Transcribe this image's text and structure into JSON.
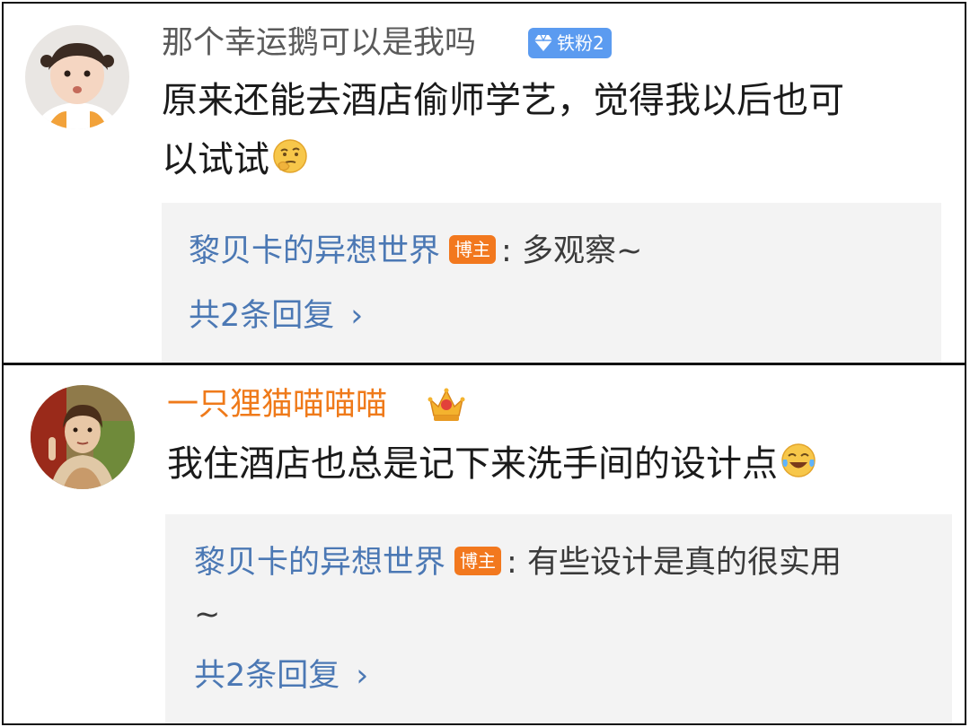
{
  "comments": [
    {
      "username": "那个幸运鹅可以是我吗",
      "fan_badge": "铁粉2",
      "text_line1": "原来还能去酒店偷师学艺，觉得我以后也可",
      "text_line2": "以试试",
      "emoji": "thinking-face-emoji",
      "reply": {
        "author": "黎贝卡的异想世界",
        "badge": "博主",
        "separator": ":",
        "text_line1": "多观察~",
        "text_line2": ""
      },
      "reply_count": "共2条回复",
      "reply_chevron": "›"
    },
    {
      "username": "一只狸猫喵喵喵",
      "vip_icon": "crown-icon",
      "text_line1": "我住酒店也总是记下来洗手间的设计点",
      "emoji": "tears-of-joy-emoji",
      "reply": {
        "author": "黎贝卡的异想世界",
        "badge": "博主",
        "separator": ":",
        "text_line1": "有些设计是真的很实用",
        "text_line2": "~"
      },
      "reply_count": "共2条回复",
      "reply_chevron": "›"
    }
  ],
  "colors": {
    "link_blue": "#4b78b4",
    "owner_badge": "#f2781e",
    "fan_badge": "#5b9bf0",
    "vip_name": "#ef7a1a",
    "reply_bg": "#f3f3f3"
  }
}
